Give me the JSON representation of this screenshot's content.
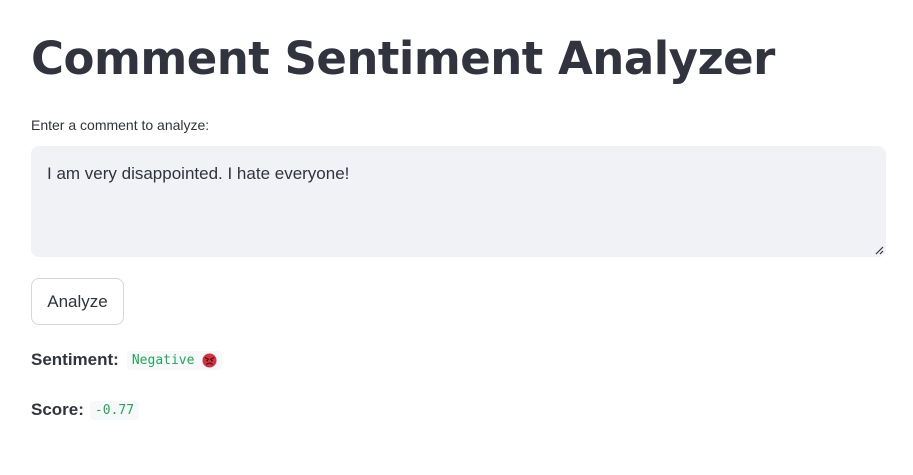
{
  "page": {
    "title": "Comment Sentiment Analyzer"
  },
  "input": {
    "label": "Enter a comment to analyze:",
    "value": "I am very disappointed. I hate everyone!"
  },
  "actions": {
    "analyze_label": "Analyze"
  },
  "result": {
    "sentiment_label": "Sentiment:",
    "sentiment_value": "Negative",
    "sentiment_icon": "angry-face-icon",
    "score_label": "Score:",
    "score_value": "-0.77"
  },
  "colors": {
    "text": "#31333f",
    "code_text": "#21a85a",
    "input_bg": "#f0f2f6",
    "emoji_red": "#d9303e"
  }
}
